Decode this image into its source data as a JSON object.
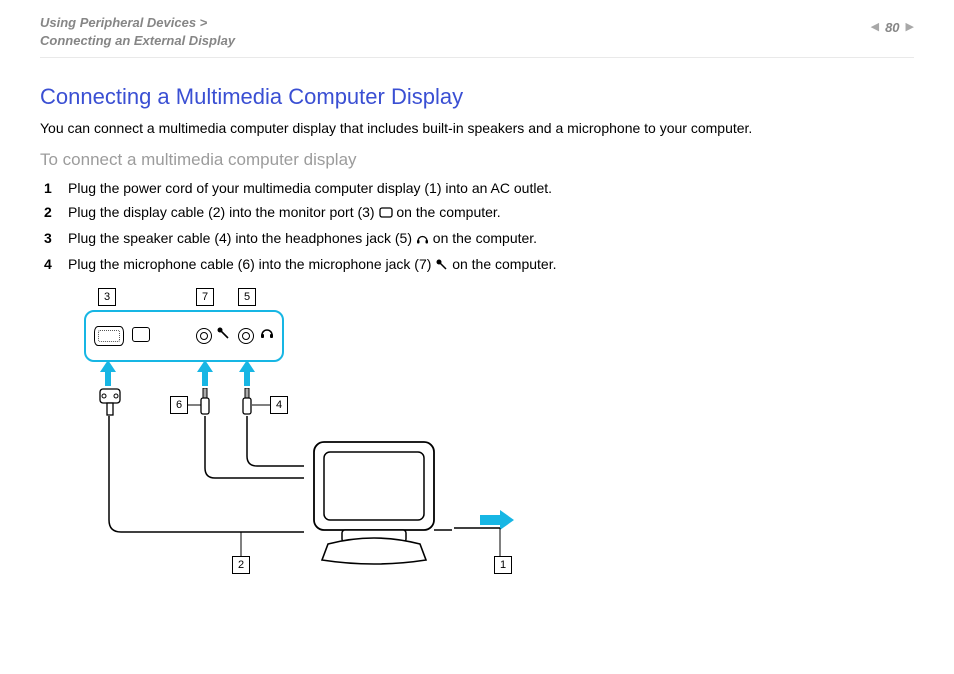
{
  "header": {
    "breadcrumb_l1": "Using Peripheral Devices >",
    "breadcrumb_l2": "Connecting an External Display",
    "page_number": "80"
  },
  "main": {
    "title": "Connecting a Multimedia Computer Display",
    "intro": "You can connect a multimedia computer display that includes built-in speakers and a microphone to your computer.",
    "subtitle": "To connect a multimedia computer display",
    "steps": [
      {
        "text_a": "Plug the power cord of your multimedia computer display (1) into an AC outlet.",
        "icon": null,
        "text_b": ""
      },
      {
        "text_a": "Plug the display cable (2) into the monitor port (3) ",
        "icon": "monitor-port-icon",
        "text_b": " on the computer."
      },
      {
        "text_a": "Plug the speaker cable (4) into the headphones jack (5) ",
        "icon": "headphones-icon",
        "text_b": " on the computer."
      },
      {
        "text_a": "Plug the microphone cable (6) into the microphone jack (7) ",
        "icon": "microphone-icon",
        "text_b": " on the computer."
      }
    ]
  },
  "diagram": {
    "callouts": {
      "c1": "1",
      "c2": "2",
      "c3": "3",
      "c4": "4",
      "c5": "5",
      "c6": "6",
      "c7": "7"
    }
  }
}
